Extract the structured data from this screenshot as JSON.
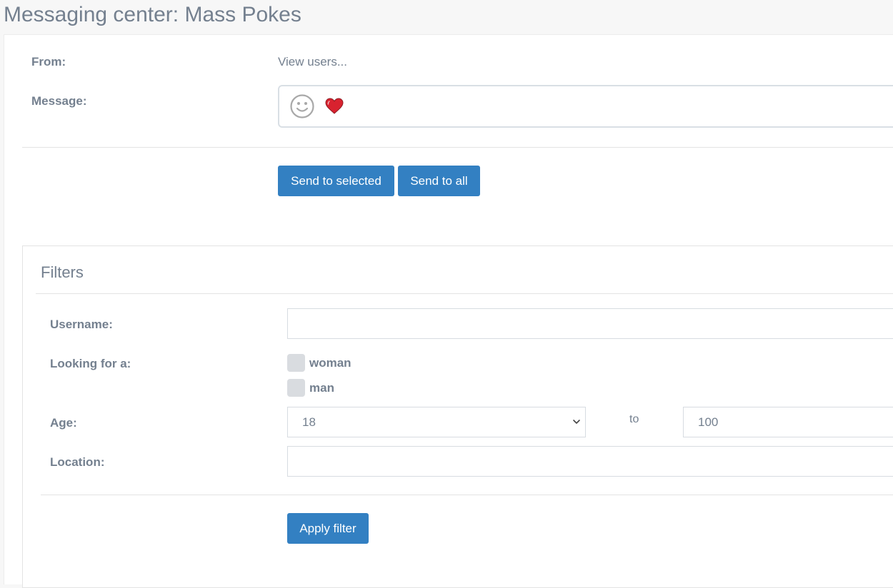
{
  "header": {
    "title": "Messaging center: Mass Pokes"
  },
  "form": {
    "from_label": "From:",
    "from_value": "View users...",
    "message_label": "Message:",
    "message_icons": [
      "smiley-icon",
      "heart-icon"
    ],
    "send_selected_label": "Send to selected",
    "send_all_label": "Send to all"
  },
  "filters": {
    "title": "Filters",
    "username_label": "Username:",
    "username_value": "",
    "looking_for_label": "Looking for a:",
    "options": [
      "woman",
      "man"
    ],
    "age_label": "Age:",
    "age_from": "18",
    "age_to_label": "to",
    "age_to": "100",
    "location_label": "Location:",
    "location_value": "",
    "apply_label": "Apply filter"
  },
  "colors": {
    "accent": "#3380c2",
    "text": "#74808f",
    "background": "#f7f7f7"
  }
}
